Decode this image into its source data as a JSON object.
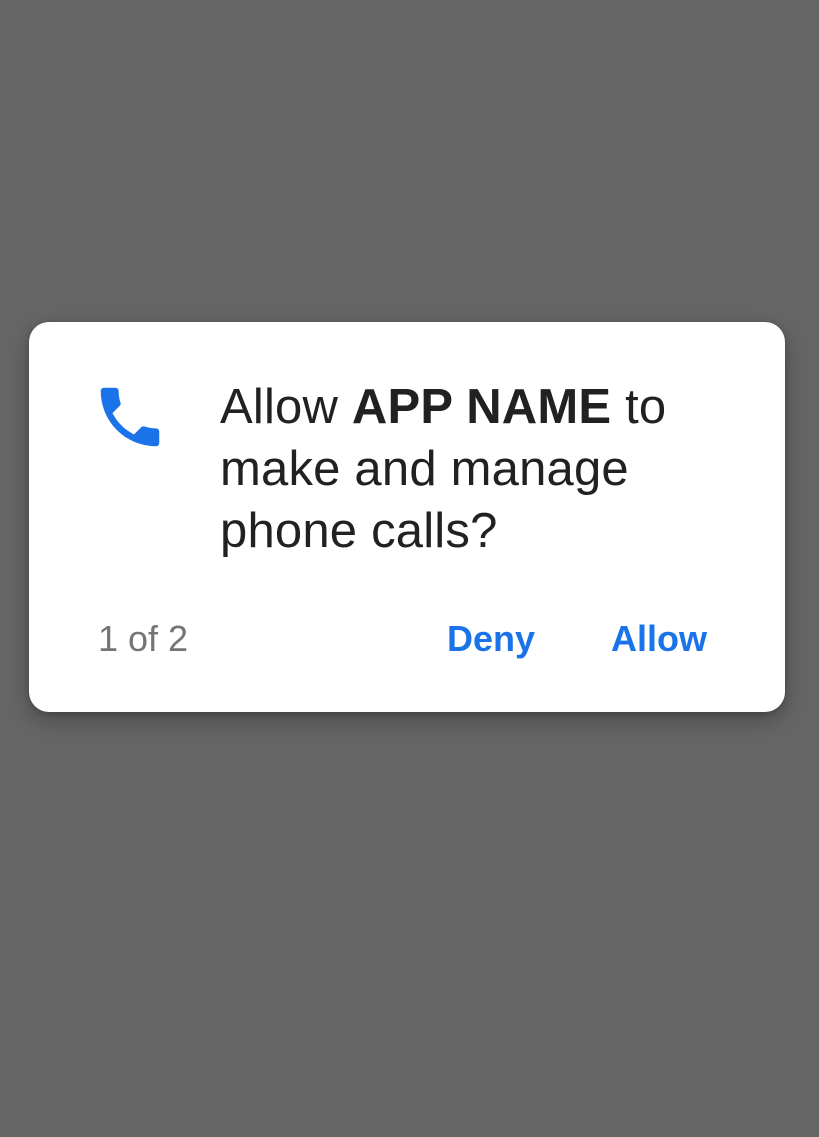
{
  "dialog": {
    "icon": "phone-icon",
    "message": {
      "prefix": "Allow",
      "app_name": "APP NAME",
      "suffix": "to make and manage phone calls?"
    },
    "counter": "1 of 2",
    "deny_label": "Deny",
    "allow_label": "Allow"
  },
  "colors": {
    "background": "#666666",
    "dialog": "#ffffff",
    "accent": "#1a73e8",
    "text": "#212121",
    "muted": "#757575"
  }
}
